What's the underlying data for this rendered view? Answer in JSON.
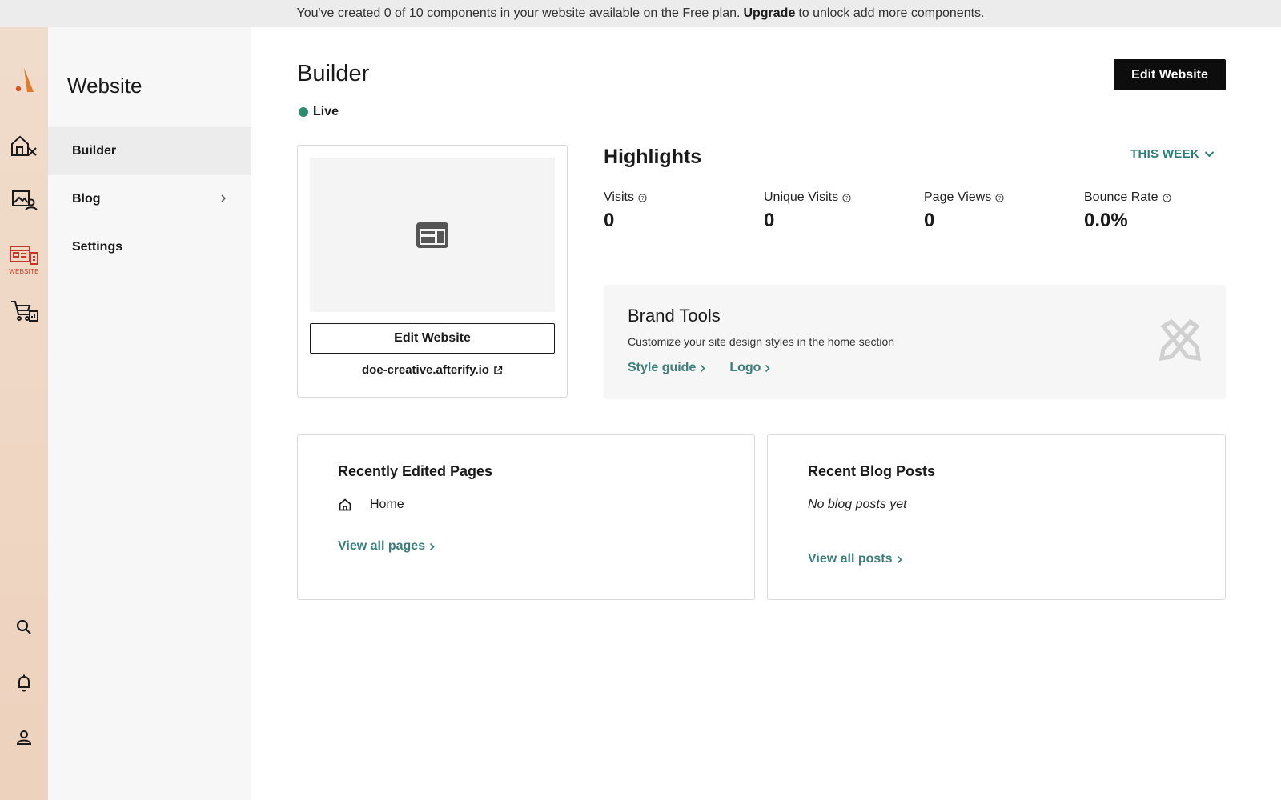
{
  "banner": {
    "prefix": "You've created 0 of 10 components in your website available on the Free plan.",
    "upgrade_label": "Upgrade",
    "suffix": "to unlock add more components."
  },
  "rail": {
    "items": [
      {
        "name": "logo-icon"
      },
      {
        "name": "home-tools-icon"
      },
      {
        "name": "media-user-icon"
      },
      {
        "name": "website-icon",
        "caption": "WEBSITE",
        "active": true
      },
      {
        "name": "cart-stats-icon"
      },
      {
        "name": "search-icon"
      },
      {
        "name": "bell-icon"
      },
      {
        "name": "user-icon"
      }
    ],
    "active_color": "#c0392b"
  },
  "subnav": {
    "title": "Website",
    "items": [
      {
        "label": "Builder",
        "active": true
      },
      {
        "label": "Blog",
        "has_children": true
      },
      {
        "label": "Settings"
      }
    ]
  },
  "main": {
    "title": "Builder",
    "status": "Live",
    "status_color": "#2e8b6e",
    "edit_button": "Edit Website",
    "preview": {
      "edit_button": "Edit Website",
      "url": "doe-creative.afterify.io"
    },
    "highlights": {
      "title": "Highlights",
      "period": "THIS WEEK",
      "metrics": [
        {
          "label": "Visits",
          "value": "0"
        },
        {
          "label": "Unique Visits",
          "value": "0"
        },
        {
          "label": "Page Views",
          "value": "0"
        },
        {
          "label": "Bounce Rate",
          "value": "0.0%"
        }
      ]
    },
    "brand_tools": {
      "title": "Brand Tools",
      "description": "Customize your site design styles in the home section",
      "links": [
        "Style guide",
        "Logo"
      ]
    },
    "recent_pages": {
      "title": "Recently Edited Pages",
      "pages": [
        "Home"
      ],
      "view_all": "View all pages"
    },
    "recent_posts": {
      "title": "Recent Blog Posts",
      "empty": "No blog posts yet",
      "view_all": "View all posts"
    }
  },
  "colors": {
    "accent": "#3b7e7a",
    "rail_bg": "#edd2bd"
  }
}
